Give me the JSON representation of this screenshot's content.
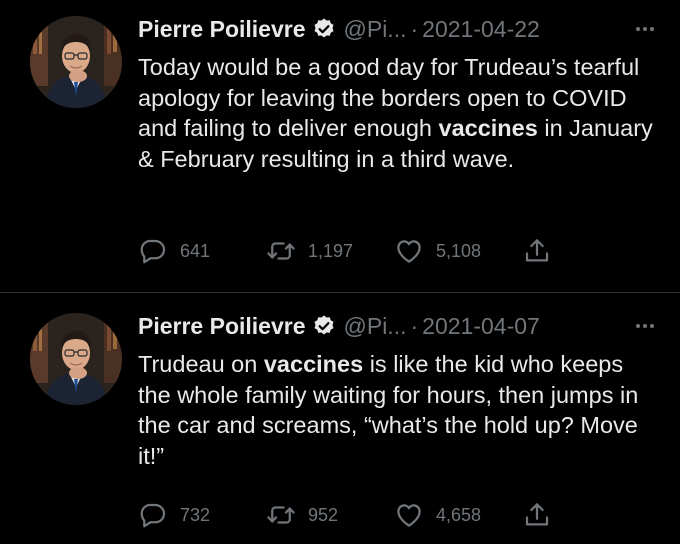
{
  "tweets": [
    {
      "author_name": "Pierre Poilievre",
      "handle": "@Pi...",
      "separator": "·",
      "date": "2021-04-22",
      "text_parts": [
        "Today would be a good day for Trudeau’s tearful apology for leaving the borders open to COVID and failing to deliver enough ",
        "vaccines",
        " in January & February resulting in a third wave."
      ],
      "replies": "641",
      "retweets": "1,197",
      "likes": "5,108"
    },
    {
      "author_name": "Pierre Poilievre",
      "handle": "@Pi...",
      "separator": "·",
      "date": "2021-04-07",
      "text_parts": [
        "Trudeau on ",
        "vaccines",
        " is like the kid who keeps the whole family waiting for hours, then jumps in the car and screams, “what’s the hold up? Move it!”"
      ],
      "replies": "732",
      "retweets": "952",
      "likes": "4,658"
    }
  ],
  "icons": {
    "verified": "verified-badge-icon",
    "more": "more-dots-icon",
    "reply": "reply-icon",
    "retweet": "retweet-icon",
    "like": "like-icon",
    "share": "share-icon"
  },
  "colors": {
    "background": "#000000",
    "text": "#e7e9ea",
    "secondary": "#71767b",
    "divider": "#2f3336"
  }
}
